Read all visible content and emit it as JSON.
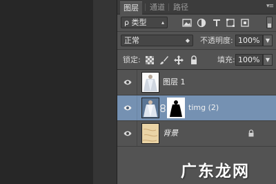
{
  "tabs": [
    {
      "label": "图层",
      "active": true
    },
    {
      "label": "通道",
      "active": false
    },
    {
      "label": "路径",
      "active": false
    }
  ],
  "filter": {
    "label": "ρ 类型"
  },
  "blend_mode": {
    "label": "正常"
  },
  "opacity": {
    "label": "不透明度:",
    "value": "100%"
  },
  "lock": {
    "label": "锁定:"
  },
  "fill": {
    "label": "填充:",
    "value": "100%"
  },
  "layers": [
    {
      "name": "图层 1",
      "selected": false,
      "visible": true
    },
    {
      "name": "timg (2)",
      "selected": true,
      "visible": true,
      "has_mask": true
    },
    {
      "name": "背景",
      "selected": false,
      "visible": true,
      "locked": true
    }
  ],
  "watermark": "广东龙网",
  "colors": {
    "selected_layer": "#7591b2",
    "panel_bg": "#535353",
    "tab_bar": "#3c3c3c"
  }
}
